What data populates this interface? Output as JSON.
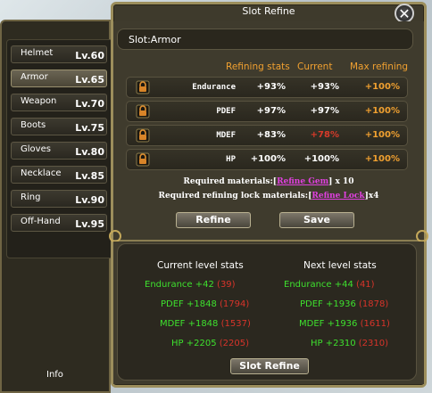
{
  "window": {
    "title": "Slot Refine",
    "close_icon": "close-icon"
  },
  "left_panel": {
    "slots": [
      {
        "name": "Helmet",
        "level": "Lv.60"
      },
      {
        "name": "Armor",
        "level": "Lv.65",
        "selected": true
      },
      {
        "name": "Weapon",
        "level": "Lv.70"
      },
      {
        "name": "Boots",
        "level": "Lv.75"
      },
      {
        "name": "Gloves",
        "level": "Lv.80"
      },
      {
        "name": "Necklace",
        "level": "Lv.85"
      },
      {
        "name": "Ring",
        "level": "Lv.90"
      },
      {
        "name": "Off-Hand",
        "level": "Lv.95"
      }
    ],
    "info_label": "Info"
  },
  "refine": {
    "slot_label": "Slot:Armor",
    "columns": {
      "refining": "Refining stats",
      "current": "Current",
      "max": "Max refining"
    },
    "rows": [
      {
        "stat": "Endurance",
        "refining": "+93%",
        "current": "+93%",
        "max": "+100%",
        "lock_icon": "lock-icon"
      },
      {
        "stat": "PDEF",
        "refining": "+97%",
        "current": "+97%",
        "max": "+100%",
        "lock_icon": "lock-icon"
      },
      {
        "stat": "MDEF",
        "refining": "+83%",
        "current": "+78%",
        "max": "+100%",
        "lock_icon": "lock-icon"
      },
      {
        "stat": "HP",
        "refining": "+100%",
        "current": "+100%",
        "max": "+100%",
        "lock_icon": "lock-icon"
      }
    ],
    "req_materials_prefix": "Required materials:[",
    "req_materials_item": "Refine Gem",
    "req_materials_suffix": "] x 10",
    "req_lock_prefix": "Required refining lock materials:[",
    "req_lock_item": "Refine Lock",
    "req_lock_suffix": "]x4",
    "refine_button": "Refine",
    "save_button": "Save"
  },
  "stats": {
    "current_head": "Current level stats",
    "next_head": "Next level stats",
    "current": [
      {
        "label": "Endurance +42",
        "extra": "(39)"
      },
      {
        "label": "PDEF +1848",
        "extra": "(1794)"
      },
      {
        "label": "MDEF +1848",
        "extra": "(1537)"
      },
      {
        "label": "HP +2205",
        "extra": "(2205)"
      }
    ],
    "next": [
      {
        "label": "Endurance +44",
        "extra": "(41)"
      },
      {
        "label": "PDEF +1936",
        "extra": "(1878)"
      },
      {
        "label": "MDEF +1936",
        "extra": "(1611)"
      },
      {
        "label": "HP +2310",
        "extra": "(2310)"
      }
    ],
    "slot_refine_button": "Slot Refine"
  },
  "colors": {
    "accent_orange": "#f0a030",
    "stat_green": "#3ee02e",
    "stat_red": "#d8342a",
    "link_magenta": "#e040e0",
    "frame_gold": "#9c8e5c"
  }
}
